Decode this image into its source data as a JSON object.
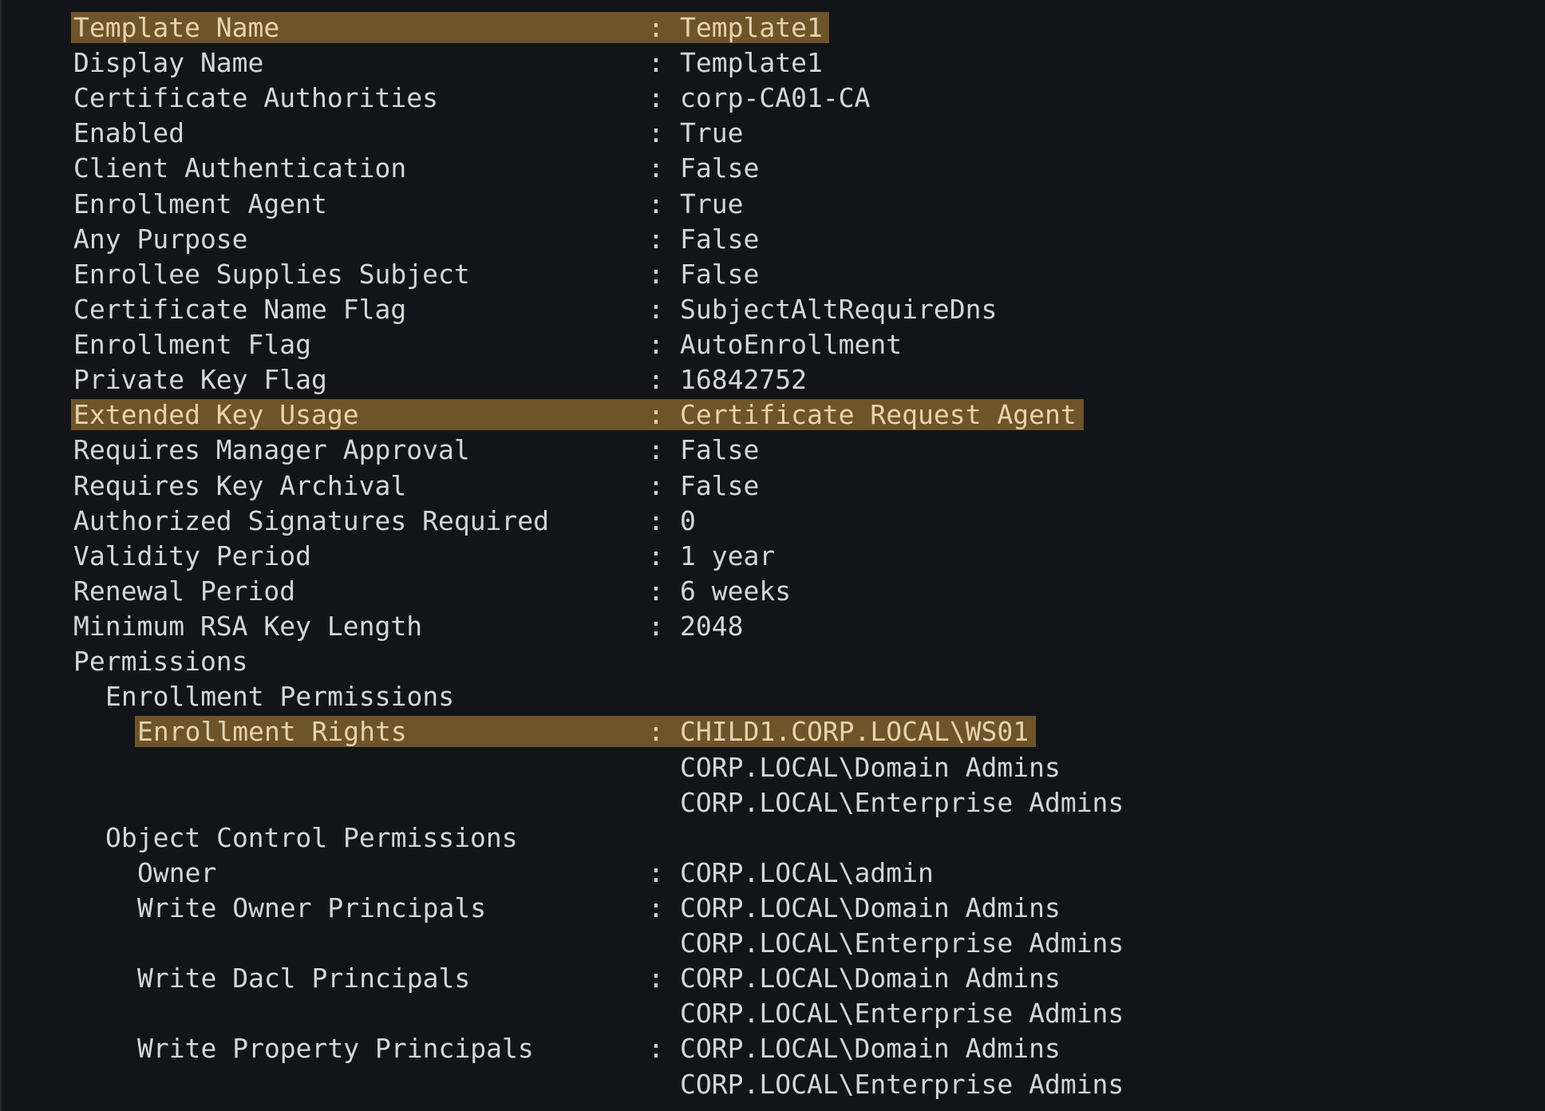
{
  "terminal": {
    "colors": {
      "background": "#131419",
      "text": "#d4d6d8",
      "highlight": "#6e5429",
      "highlight_text": "#e6d3ae"
    },
    "lines": [
      {
        "name": "template-name",
        "label": "Template Name",
        "separator": ":",
        "value": "Template1",
        "indent": 0,
        "highlight": true
      },
      {
        "name": "display-name",
        "label": "Display Name",
        "separator": ":",
        "value": "Template1",
        "indent": 0,
        "highlight": false
      },
      {
        "name": "certificate-authorities",
        "label": "Certificate Authorities",
        "separator": ":",
        "value": "corp-CA01-CA",
        "indent": 0,
        "highlight": false
      },
      {
        "name": "enabled",
        "label": "Enabled",
        "separator": ":",
        "value": "True",
        "indent": 0,
        "highlight": false
      },
      {
        "name": "client-authentication",
        "label": "Client Authentication",
        "separator": ":",
        "value": "False",
        "indent": 0,
        "highlight": false
      },
      {
        "name": "enrollment-agent",
        "label": "Enrollment Agent",
        "separator": ":",
        "value": "True",
        "indent": 0,
        "highlight": false
      },
      {
        "name": "any-purpose",
        "label": "Any Purpose",
        "separator": ":",
        "value": "False",
        "indent": 0,
        "highlight": false
      },
      {
        "name": "enrollee-supplies-subject",
        "label": "Enrollee Supplies Subject",
        "separator": ":",
        "value": "False",
        "indent": 0,
        "highlight": false
      },
      {
        "name": "certificate-name-flag",
        "label": "Certificate Name Flag",
        "separator": ":",
        "value": "SubjectAltRequireDns",
        "indent": 0,
        "highlight": false
      },
      {
        "name": "enrollment-flag",
        "label": "Enrollment Flag",
        "separator": ":",
        "value": "AutoEnrollment",
        "indent": 0,
        "highlight": false
      },
      {
        "name": "private-key-flag",
        "label": "Private Key Flag",
        "separator": ":",
        "value": "16842752",
        "indent": 0,
        "highlight": false
      },
      {
        "name": "extended-key-usage",
        "label": "Extended Key Usage",
        "separator": ":",
        "value": "Certificate Request Agent",
        "indent": 0,
        "highlight": true
      },
      {
        "name": "requires-manager-approval",
        "label": "Requires Manager Approval",
        "separator": ":",
        "value": "False",
        "indent": 0,
        "highlight": false
      },
      {
        "name": "requires-key-archival",
        "label": "Requires Key Archival",
        "separator": ":",
        "value": "False",
        "indent": 0,
        "highlight": false
      },
      {
        "name": "authorized-signatures-required",
        "label": "Authorized Signatures Required",
        "separator": ":",
        "value": "0",
        "indent": 0,
        "highlight": false
      },
      {
        "name": "validity-period",
        "label": "Validity Period",
        "separator": ":",
        "value": "1 year",
        "indent": 0,
        "highlight": false
      },
      {
        "name": "renewal-period",
        "label": "Renewal Period",
        "separator": ":",
        "value": "6 weeks",
        "indent": 0,
        "highlight": false
      },
      {
        "name": "minimum-rsa-key-length",
        "label": "Minimum RSA Key Length",
        "separator": ":",
        "value": "2048",
        "indent": 0,
        "highlight": false
      },
      {
        "name": "permissions-heading",
        "label": "Permissions",
        "separator": "",
        "value": "",
        "indent": 0,
        "highlight": false
      },
      {
        "name": "enrollment-permissions-heading",
        "label": "Enrollment Permissions",
        "separator": "",
        "value": "",
        "indent": 1,
        "highlight": false
      },
      {
        "name": "enrollment-rights",
        "label": "Enrollment Rights",
        "separator": ":",
        "value": "CHILD1.CORP.LOCAL\\WS01",
        "indent": 2,
        "highlight": true
      },
      {
        "name": "enrollment-rights-cont-1",
        "label": "",
        "separator": "",
        "value": "CORP.LOCAL\\Domain Admins",
        "indent": 0,
        "highlight": false
      },
      {
        "name": "enrollment-rights-cont-2",
        "label": "",
        "separator": "",
        "value": "CORP.LOCAL\\Enterprise Admins",
        "indent": 0,
        "highlight": false
      },
      {
        "name": "object-control-permissions-heading",
        "label": "Object Control Permissions",
        "separator": "",
        "value": "",
        "indent": 1,
        "highlight": false
      },
      {
        "name": "owner",
        "label": "Owner",
        "separator": ":",
        "value": "CORP.LOCAL\\admin",
        "indent": 2,
        "highlight": false
      },
      {
        "name": "write-owner-principals",
        "label": "Write Owner Principals",
        "separator": ":",
        "value": "CORP.LOCAL\\Domain Admins",
        "indent": 2,
        "highlight": false
      },
      {
        "name": "write-owner-principals-cont-1",
        "label": "",
        "separator": "",
        "value": "CORP.LOCAL\\Enterprise Admins",
        "indent": 0,
        "highlight": false
      },
      {
        "name": "write-dacl-principals",
        "label": "Write Dacl Principals",
        "separator": ":",
        "value": "CORP.LOCAL\\Domain Admins",
        "indent": 2,
        "highlight": false
      },
      {
        "name": "write-dacl-principals-cont-1",
        "label": "",
        "separator": "",
        "value": "CORP.LOCAL\\Enterprise Admins",
        "indent": 0,
        "highlight": false
      },
      {
        "name": "write-property-principals",
        "label": "Write Property Principals",
        "separator": ":",
        "value": "CORP.LOCAL\\Domain Admins",
        "indent": 2,
        "highlight": false
      },
      {
        "name": "write-property-principals-cont-1",
        "label": "",
        "separator": "",
        "value": "CORP.LOCAL\\Enterprise Admins",
        "indent": 0,
        "highlight": false
      }
    ]
  }
}
